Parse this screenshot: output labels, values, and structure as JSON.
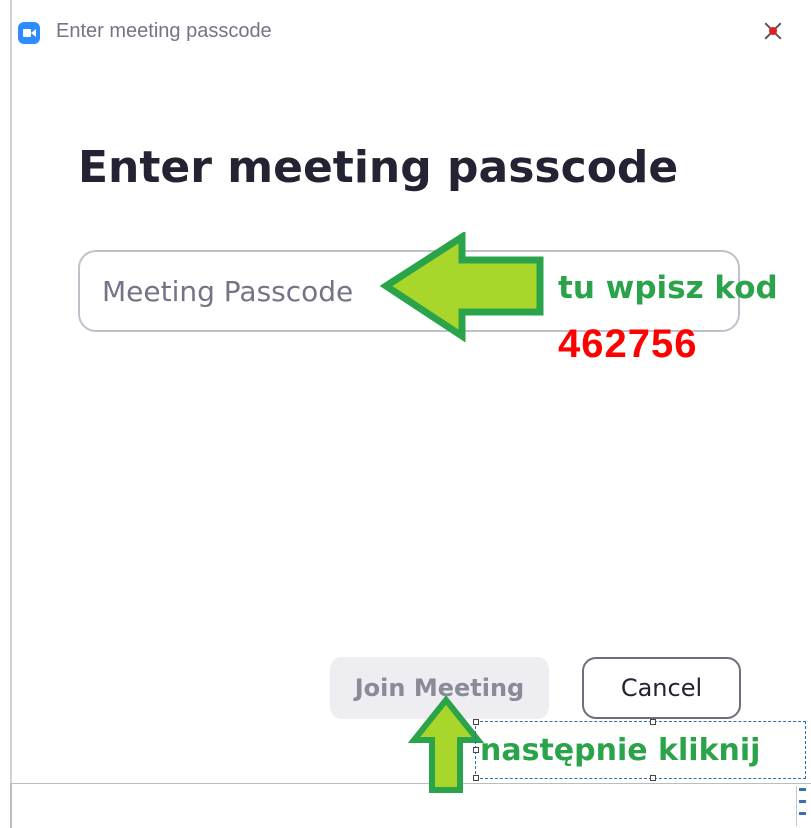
{
  "window": {
    "title": "Enter meeting passcode",
    "app_icon": "zoom-camera-icon",
    "close_icon": "close-icon"
  },
  "dialog": {
    "heading": "Enter meeting passcode",
    "passcode_field": {
      "placeholder": "Meeting Passcode",
      "value": ""
    },
    "buttons": {
      "join_label": "Join Meeting",
      "cancel_label": "Cancel"
    }
  },
  "annotations": {
    "input_hint": "tu wpisz kod",
    "passcode_code": "462756",
    "button_hint": "następnie kliknij",
    "arrow_color": "#a8d62a",
    "arrow_outline": "#2aa34a",
    "code_color": "#ff0000"
  },
  "colors": {
    "zoom_blue": "#2d8cff",
    "heading": "#232333",
    "muted": "#747487"
  }
}
